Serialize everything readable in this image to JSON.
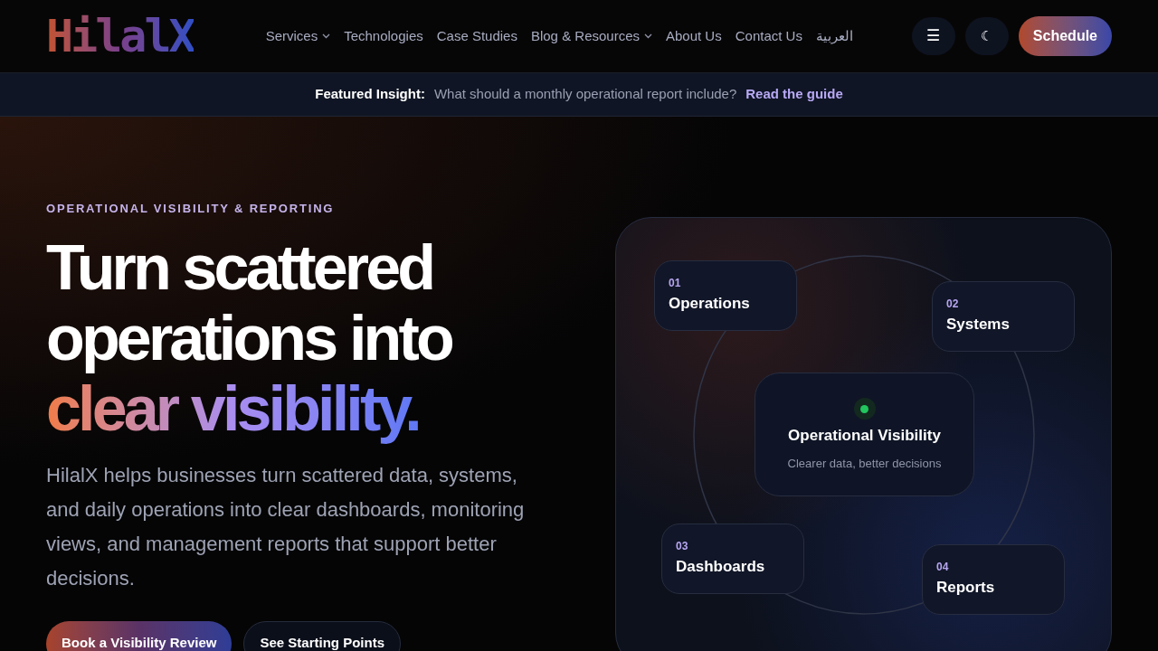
{
  "header": {
    "logo": "HilalX",
    "nav": [
      {
        "label": "Services",
        "dropdown": true
      },
      {
        "label": "Technologies",
        "dropdown": false
      },
      {
        "label": "Case Studies",
        "dropdown": false
      },
      {
        "label": "Blog & Resources",
        "dropdown": true
      },
      {
        "label": "About Us",
        "dropdown": false
      },
      {
        "label": "Contact Us",
        "dropdown": false
      },
      {
        "label": "العربية",
        "dropdown": false
      }
    ],
    "menu_button": "☰",
    "theme_button": "☾",
    "cta": "Schedule"
  },
  "banner": {
    "label": "Featured Insight:",
    "text": "What should a monthly operational report include?",
    "link": "Read the guide"
  },
  "hero": {
    "eyebrow": "OPERATIONAL VISIBILITY & REPORTING",
    "headline": [
      "Turn scattered",
      "operations into"
    ],
    "highlight": "clear visibility.",
    "description": "HilalX helps businesses turn scattered data, systems, and daily operations into clear dashboards, monitoring views, and management reports that support better decisions.",
    "buttons": [
      {
        "label": "Book a Visibility Review",
        "kind": "primary"
      },
      {
        "label": "See Starting Points",
        "kind": "secondary"
      }
    ]
  },
  "diagram": {
    "center": {
      "title": "Operational Visibility",
      "subtitle": "Clearer data, better decisions",
      "color": "#22c55e"
    },
    "nodes": [
      {
        "number": "01",
        "label": "Operations"
      },
      {
        "number": "02",
        "label": "Systems"
      },
      {
        "number": "03",
        "label": "Dashboards"
      },
      {
        "number": "04",
        "label": "Reports"
      }
    ]
  }
}
